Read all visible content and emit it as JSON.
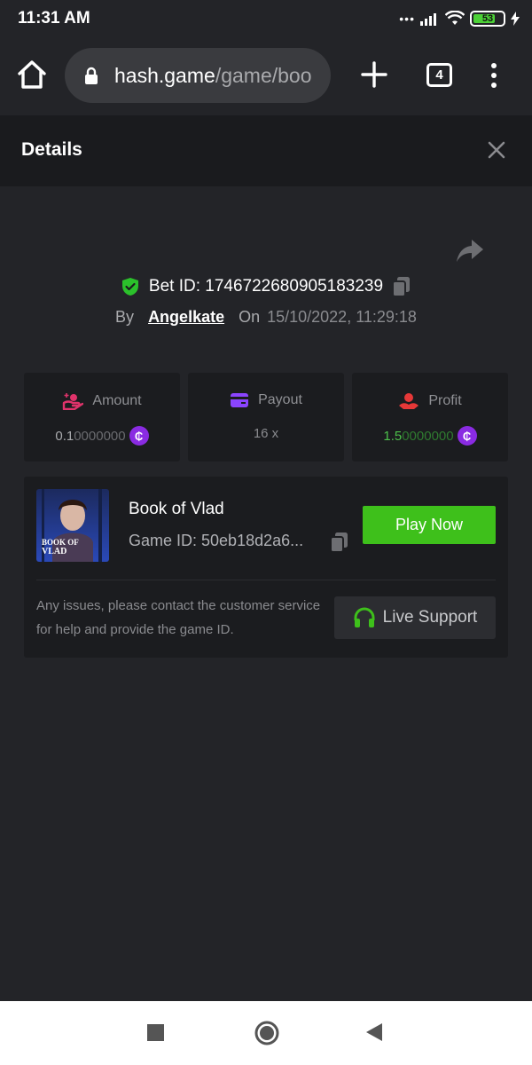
{
  "status_bar": {
    "time": "11:31 AM",
    "signal_dots": "•••",
    "battery": "53"
  },
  "browser": {
    "url_host": "hash.game",
    "url_path": "/game/boo",
    "tab_count": "4"
  },
  "details": {
    "title": "Details"
  },
  "bet": {
    "label": "Bet ID: 1746722680905183239",
    "by_label": "By",
    "user": "Angelkate",
    "on_label": "On",
    "date": "15/10/2022, 11:29:18"
  },
  "stats": {
    "amount": {
      "label": "Amount",
      "value_strong": "0.1",
      "value_dim": "0000000",
      "currency_icon": "coin-icon"
    },
    "payout": {
      "label": "Payout",
      "value": "16 x"
    },
    "profit": {
      "label": "Profit",
      "value_strong": "1.5",
      "value_dim": "0000000",
      "currency_icon": "coin-icon"
    }
  },
  "game": {
    "name": "Book of Vlad",
    "id_label": "Game ID: 50eb18d2a6...",
    "play_button": "Play Now",
    "thumb_text": "BOOK OF VLAD",
    "support_text": "Any issues, please contact the customer service for help and provide the game ID.",
    "support_button": "Live Support"
  },
  "colors": {
    "background": "#232428",
    "header": "#1a1b1e",
    "card": "#1b1c1f",
    "play_green": "#3ec01b",
    "profit_green": "#4cc14a",
    "coin_purple": "#8a2be2",
    "amount_pink": "#e0336b",
    "payout_purple": "#8b44ff",
    "profit_red": "#e63838",
    "shield_green": "#2bc12b"
  }
}
